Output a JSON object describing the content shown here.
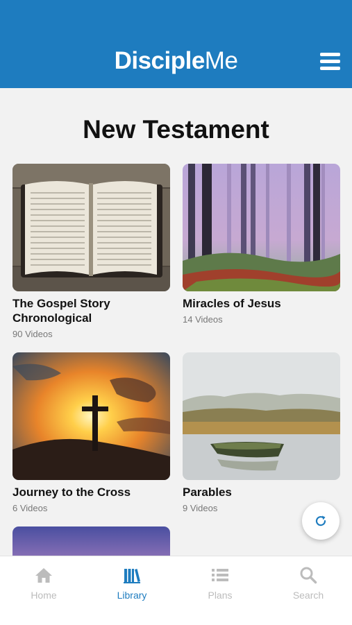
{
  "header": {
    "logo_bold": "Disciple",
    "logo_light": "Me",
    "menu_icon": "hamburger-menu-icon"
  },
  "page": {
    "title": "New Testament"
  },
  "series": [
    {
      "title": "The Gospel Story Chronological",
      "count": "90 Videos",
      "image": "open-bible"
    },
    {
      "title": "Miracles of Jesus",
      "count": "14 Videos",
      "image": "misty-forest"
    },
    {
      "title": "Journey to the Cross",
      "count": "6 Videos",
      "image": "cross-sunset"
    },
    {
      "title": "Parables",
      "count": "9 Videos",
      "image": "boat-on-lake"
    }
  ],
  "refresh_icon": "refresh-icon",
  "tabbar": {
    "active": "Library",
    "tabs": [
      {
        "label": "Home",
        "icon": "home-icon"
      },
      {
        "label": "Library",
        "icon": "library-icon"
      },
      {
        "label": "Plans",
        "icon": "list-icon"
      },
      {
        "label": "Search",
        "icon": "search-icon"
      }
    ]
  },
  "colors": {
    "brand": "#1e7cbf",
    "inactive": "#bcbcbc",
    "background": "#f2f2f2"
  }
}
